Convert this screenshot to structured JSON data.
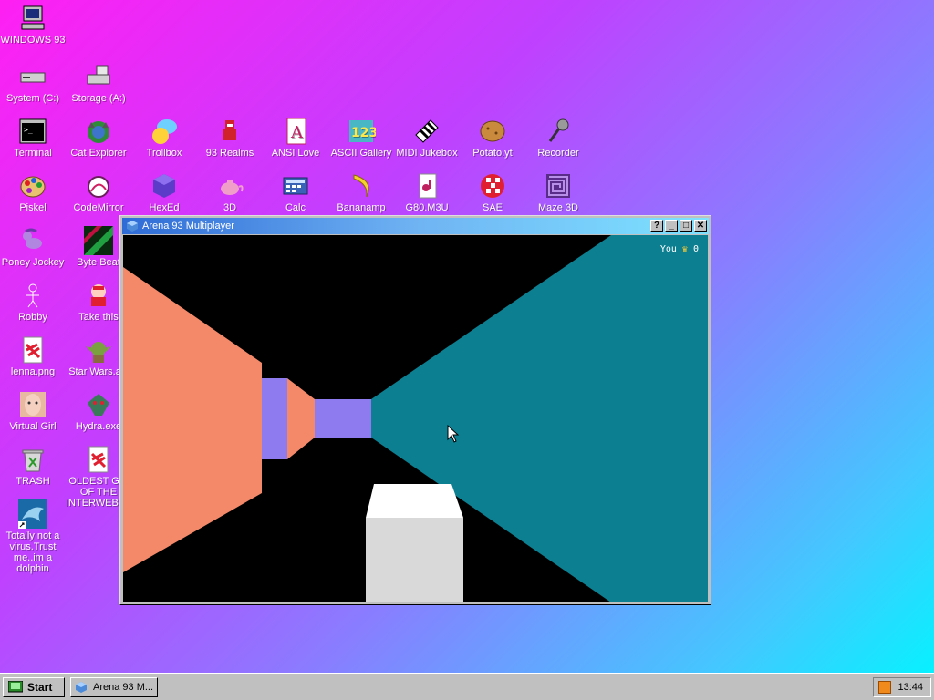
{
  "desktop_icons": [
    {
      "id": "windows93",
      "label": "WINDOWS 93"
    },
    {
      "id": "system_c",
      "label": "System (C:)"
    },
    {
      "id": "storage_a",
      "label": "Storage (A:)"
    },
    {
      "id": "terminal",
      "label": "Terminal"
    },
    {
      "id": "cat_explorer",
      "label": "Cat Explorer"
    },
    {
      "id": "trollbox",
      "label": "Trollbox"
    },
    {
      "id": "realms93",
      "label": "93 Realms"
    },
    {
      "id": "ansi_love",
      "label": "ANSI Love"
    },
    {
      "id": "ascii_gallery",
      "label": "ASCII Gallery"
    },
    {
      "id": "midi_jukebox",
      "label": "MIDI Jukebox"
    },
    {
      "id": "potato",
      "label": "Potato.yt"
    },
    {
      "id": "recorder",
      "label": "Recorder"
    },
    {
      "id": "piskel",
      "label": "Piskel"
    },
    {
      "id": "codemirror",
      "label": "CodeMirror"
    },
    {
      "id": "hexed",
      "label": "HexEd"
    },
    {
      "id": "three_d",
      "label": "3D"
    },
    {
      "id": "calc",
      "label": "Calc"
    },
    {
      "id": "bananamp",
      "label": "Bananamp"
    },
    {
      "id": "g80m3u",
      "label": "G80.M3U"
    },
    {
      "id": "sae",
      "label": "SAE"
    },
    {
      "id": "maze3d",
      "label": "Maze 3D"
    },
    {
      "id": "poney_jockey",
      "label": "Poney Jockey"
    },
    {
      "id": "byte_beat",
      "label": "Byte Beat"
    },
    {
      "id": "robby",
      "label": "Robby"
    },
    {
      "id": "take_this",
      "label": "Take this"
    },
    {
      "id": "lenna",
      "label": "lenna.png"
    },
    {
      "id": "star_wars",
      "label": "Star Wars.avi"
    },
    {
      "id": "virtual_girl",
      "label": "Virtual Girl"
    },
    {
      "id": "hydra",
      "label": "Hydra.exe"
    },
    {
      "id": "trash",
      "label": "TRASH"
    },
    {
      "id": "oldest_gif",
      "label": "OLDEST GIF OF THE INTERWEB.gif"
    },
    {
      "id": "dolphin",
      "label": "Totally not a virus.Trust me..im a dolphin"
    }
  ],
  "window": {
    "title": "Arena 93 Multiplayer",
    "buttons": {
      "help": "?",
      "minimize": "_",
      "maximize": "□",
      "close": "✕"
    },
    "hud": {
      "player": "You",
      "crown": "♛",
      "score": "0"
    }
  },
  "colors": {
    "left_wall": "#f4896a",
    "right_wall": "#0c7f91",
    "far_wall": "#8f7bf0",
    "block": "#d9d9d9",
    "title_gradient_start": "#2f6bd6",
    "title_gradient_end": "#7ee3ff"
  },
  "taskbar": {
    "start_label": "Start",
    "task_label": "Arena 93 M...",
    "time": "13:44"
  }
}
